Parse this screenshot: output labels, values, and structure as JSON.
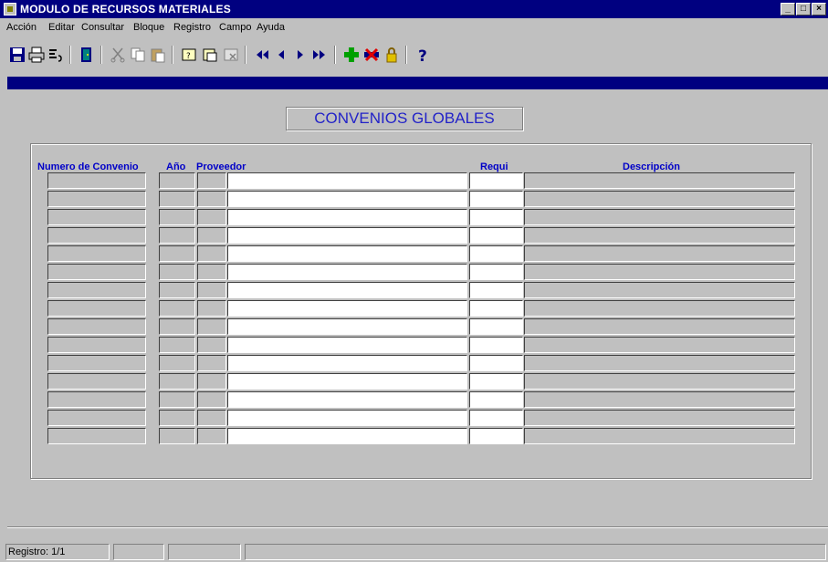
{
  "window": {
    "title": "MODULO DE RECURSOS MATERIALES",
    "minimize": "_",
    "maximize": "□",
    "close": "×"
  },
  "menu": {
    "items": [
      "Acción",
      "Editar",
      "Consultar",
      "Bloque",
      "Registro",
      "Campo",
      "Ayuda"
    ]
  },
  "toolbar": {
    "buttons": [
      {
        "name": "save-icon"
      },
      {
        "name": "print-icon"
      },
      {
        "name": "print-setup-icon"
      },
      {
        "name": "exit-icon"
      },
      {
        "name": "cut-icon"
      },
      {
        "name": "copy-icon"
      },
      {
        "name": "paste-icon"
      },
      {
        "name": "enter-query-icon"
      },
      {
        "name": "execute-query-icon"
      },
      {
        "name": "cancel-query-icon"
      },
      {
        "name": "first-record-icon"
      },
      {
        "name": "previous-record-icon"
      },
      {
        "name": "next-record-icon"
      },
      {
        "name": "last-record-icon"
      },
      {
        "name": "insert-record-icon"
      },
      {
        "name": "delete-record-icon"
      },
      {
        "name": "lock-record-icon"
      },
      {
        "name": "help-icon"
      }
    ]
  },
  "form": {
    "title": "CONVENIOS GLOBALES",
    "columns": {
      "numero": "Numero de Convenio",
      "anio": "Año",
      "proveedor": "Proveedor",
      "requi": "Requi",
      "descripcion": "Descripción"
    },
    "row_count": 15,
    "rows": []
  },
  "status": {
    "record": "Registro: 1/1",
    "fields": [
      "",
      "",
      ""
    ]
  },
  "colors": {
    "title_bar": "#000080",
    "label_blue": "#0000c8",
    "form_title": "#2222c8",
    "background": "#c0c0c0"
  }
}
